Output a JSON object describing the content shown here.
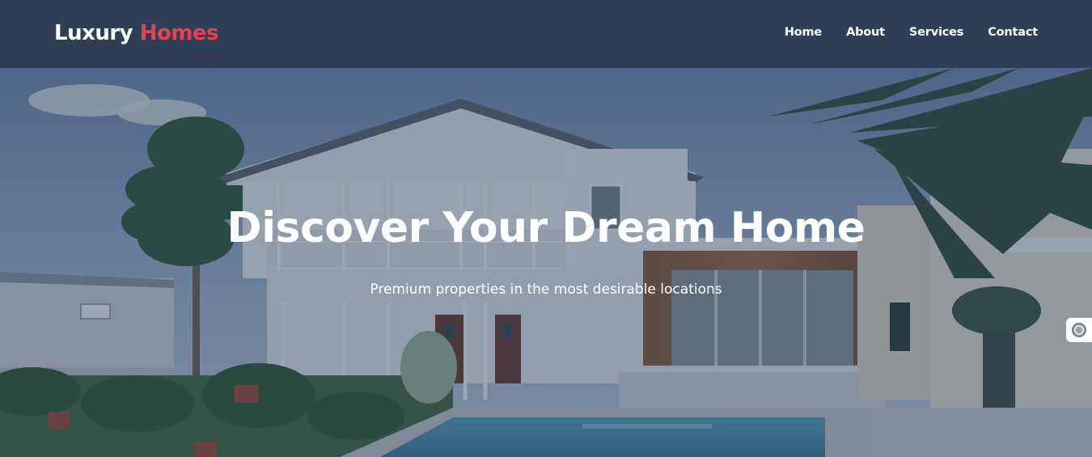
{
  "header": {
    "logo_primary": "Luxury",
    "logo_accent": "Homes",
    "nav": {
      "home": "Home",
      "about": "About",
      "services": "Services",
      "contact": "Contact"
    }
  },
  "hero": {
    "title": "Discover Your Dream Home",
    "subtitle": "Premium properties in the most desirable locations"
  },
  "side_widget": {
    "icon": "badge-icon"
  },
  "colors": {
    "header_bg": "#2e3f57",
    "accent": "#e8404f",
    "text": "#ffffff",
    "overlay": "#263752"
  }
}
